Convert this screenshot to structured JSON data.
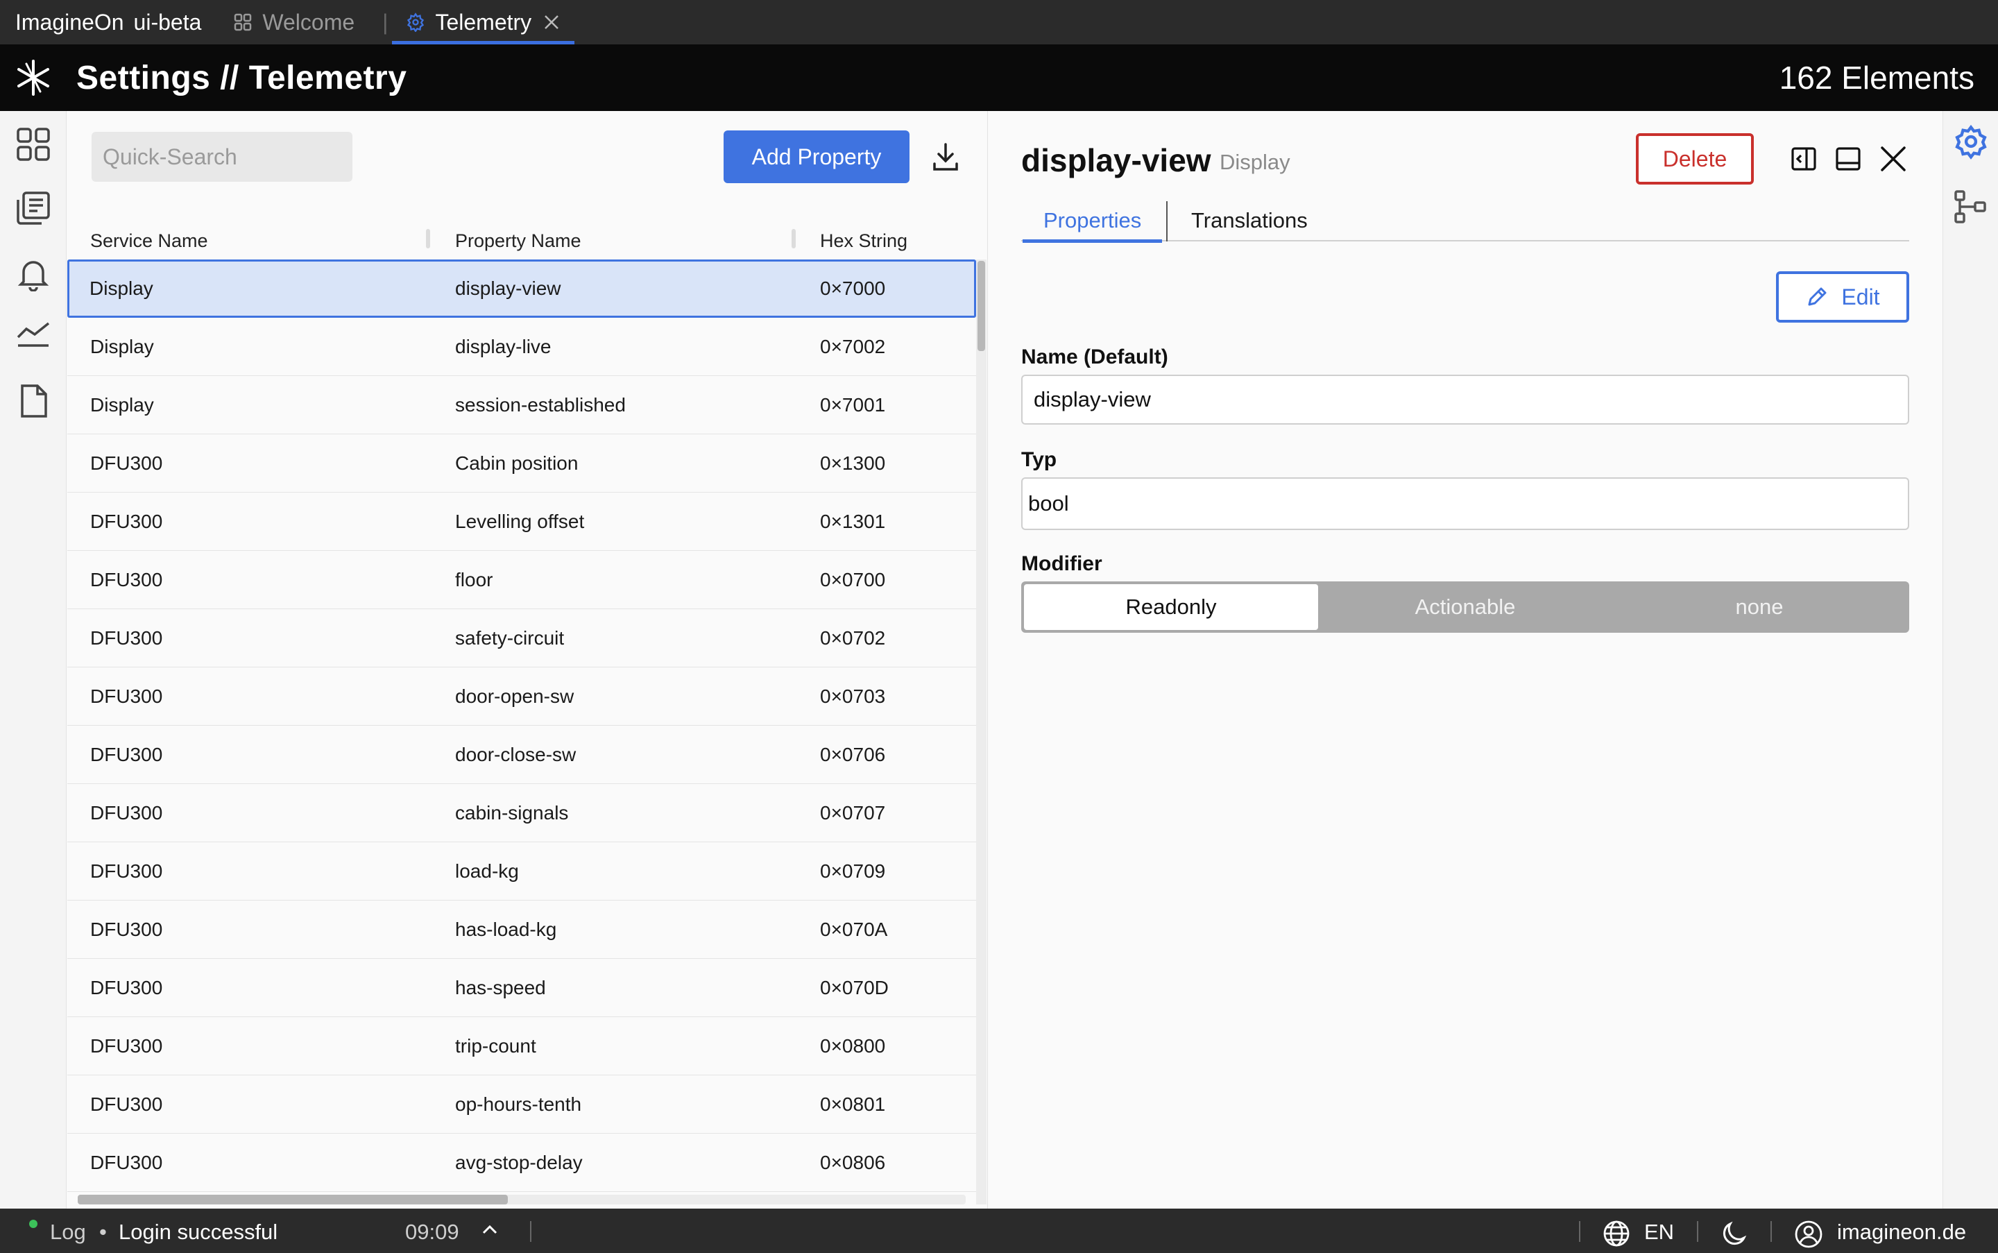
{
  "tabbar": {
    "app_name": "ImagineOn",
    "app_version": "ui-beta",
    "tabs": [
      {
        "label": "Welcome",
        "icon": "grid-icon"
      },
      {
        "label": "Telemetry",
        "icon": "gear-icon"
      }
    ]
  },
  "header": {
    "title": "Settings // Telemetry",
    "count": "162 Elements"
  },
  "list": {
    "search_placeholder": "Quick-Search",
    "add_label": "Add Property",
    "columns": [
      "Service Name",
      "Property Name",
      "Hex String"
    ],
    "rows": [
      [
        "Display",
        "display-view",
        "0×7000"
      ],
      [
        "Display",
        "display-live",
        "0×7002"
      ],
      [
        "Display",
        "session-established",
        "0×7001"
      ],
      [
        "DFU300",
        "Cabin position",
        "0×1300"
      ],
      [
        "DFU300",
        "Levelling offset",
        "0×1301"
      ],
      [
        "DFU300",
        "floor",
        "0×0700"
      ],
      [
        "DFU300",
        "safety-circuit",
        "0×0702"
      ],
      [
        "DFU300",
        "door-open-sw",
        "0×0703"
      ],
      [
        "DFU300",
        "door-close-sw",
        "0×0706"
      ],
      [
        "DFU300",
        "cabin-signals",
        "0×0707"
      ],
      [
        "DFU300",
        "load-kg",
        "0×0709"
      ],
      [
        "DFU300",
        "has-load-kg",
        "0×070A"
      ],
      [
        "DFU300",
        "has-speed",
        "0×070D"
      ],
      [
        "DFU300",
        "trip-count",
        "0×0800"
      ],
      [
        "DFU300",
        "op-hours-tenth",
        "0×0801"
      ],
      [
        "DFU300",
        "avg-stop-delay",
        "0×0806"
      ]
    ]
  },
  "detail": {
    "title": "display-view",
    "subtitle": "Display",
    "delete_label": "Delete",
    "tabs": [
      "Properties",
      "Translations"
    ],
    "edit_label": "Edit",
    "name_label": "Name (Default)",
    "name_value": "display-view",
    "type_label": "Typ",
    "type_value": "bool",
    "modifier_label": "Modifier",
    "modifier_options": [
      "Readonly",
      "Actionable",
      "none"
    ],
    "modifier_selected": "Readonly"
  },
  "status": {
    "log_label": "Log",
    "bullet": "•",
    "message": "Login successful",
    "time": "09:09",
    "language": "EN",
    "user": "imagineon.de",
    "status_color": "#3cc25a"
  },
  "colors": {
    "accent": "#3f73e0",
    "danger": "#c9302c"
  }
}
